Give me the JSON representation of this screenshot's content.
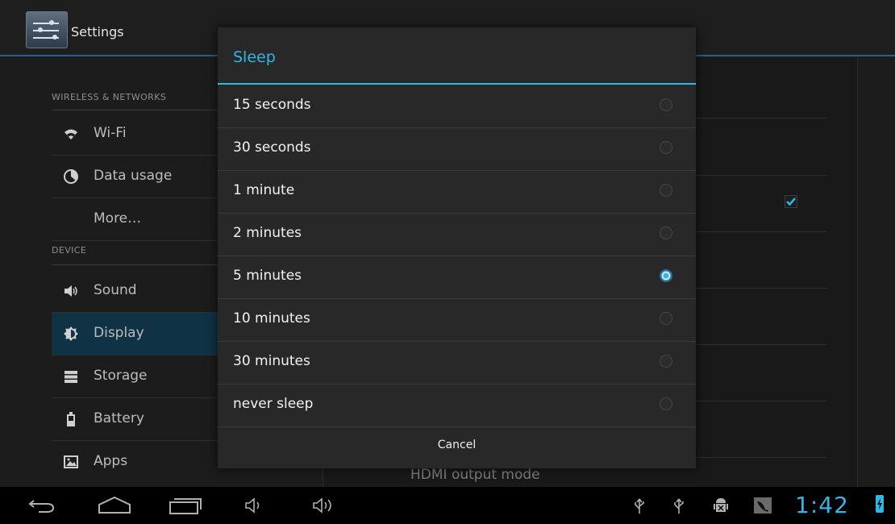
{
  "action_bar": {
    "title": "Settings",
    "icon": "settings-sliders-icon"
  },
  "left_panel": {
    "categories": [
      {
        "label": "WIRELESS & NETWORKS"
      },
      {
        "label": "DEVICE"
      }
    ],
    "items": [
      {
        "label": "Wi-Fi",
        "icon": "wifi-icon"
      },
      {
        "label": "Data usage",
        "icon": "data-usage-icon"
      },
      {
        "label": "More…",
        "icon": ""
      },
      {
        "label": "Sound",
        "icon": "speaker-icon"
      },
      {
        "label": "Display",
        "icon": "display-brightness-icon",
        "active": true
      },
      {
        "label": "Storage",
        "icon": "storage-icon"
      },
      {
        "label": "Battery",
        "icon": "battery-icon"
      },
      {
        "label": "Apps",
        "icon": "apps-icon"
      }
    ]
  },
  "right_panel": {
    "partial_item": "HDMI output mode",
    "checkbox_checked": true
  },
  "dialog": {
    "title": "Sleep",
    "options": [
      {
        "label": "15 seconds",
        "selected": false
      },
      {
        "label": "30 seconds",
        "selected": false
      },
      {
        "label": "1 minute",
        "selected": false
      },
      {
        "label": "2 minutes",
        "selected": false
      },
      {
        "label": "5 minutes",
        "selected": true
      },
      {
        "label": "10 minutes",
        "selected": false
      },
      {
        "label": "30 minutes",
        "selected": false
      },
      {
        "label": "never sleep",
        "selected": false
      }
    ],
    "cancel_label": "Cancel"
  },
  "status_bar": {
    "time": "1:42",
    "nav_icons": [
      "back-icon",
      "home-icon",
      "recent-apps-icon",
      "volume-down-icon",
      "volume-up-icon"
    ],
    "status_icons": [
      "usb-icon",
      "usb-icon",
      "android-debug-icon",
      "signal-icon",
      "battery-charging-icon"
    ]
  },
  "colors": {
    "accent": "#33b5e5",
    "active_item": "#0f3345",
    "dialog_bg": "#282828"
  }
}
